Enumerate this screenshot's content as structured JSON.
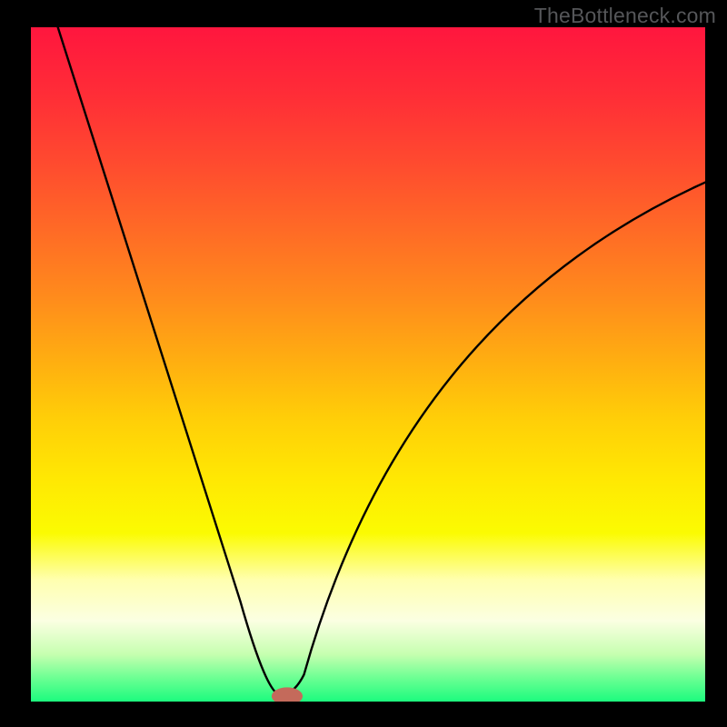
{
  "watermark": "TheBottleneck.com",
  "chart_data": {
    "type": "line",
    "title": "",
    "xlabel": "",
    "ylabel": "",
    "xlim": [
      0,
      100
    ],
    "ylim": [
      0,
      100
    ],
    "axes_visible": false,
    "grid": false,
    "background": {
      "type": "vertical_gradient",
      "stops": [
        {
          "offset": 0.0,
          "color": "#ff163e"
        },
        {
          "offset": 0.1,
          "color": "#ff2d37"
        },
        {
          "offset": 0.2,
          "color": "#ff4a2f"
        },
        {
          "offset": 0.3,
          "color": "#ff6a26"
        },
        {
          "offset": 0.4,
          "color": "#ff8b1c"
        },
        {
          "offset": 0.5,
          "color": "#ffb010"
        },
        {
          "offset": 0.58,
          "color": "#ffce08"
        },
        {
          "offset": 0.67,
          "color": "#ffe803"
        },
        {
          "offset": 0.75,
          "color": "#fbfb02"
        },
        {
          "offset": 0.82,
          "color": "#ffffb0"
        },
        {
          "offset": 0.88,
          "color": "#fbffe2"
        },
        {
          "offset": 0.93,
          "color": "#c6ffb0"
        },
        {
          "offset": 0.965,
          "color": "#6cff93"
        },
        {
          "offset": 1.0,
          "color": "#1cfb7e"
        }
      ]
    },
    "curve": {
      "description": "V-shaped bottleneck curve with smooth minimum",
      "min_x": 37,
      "min_y": 1,
      "left_top": {
        "x": 4,
        "y": 100
      },
      "right_end": {
        "x": 100,
        "y": 77
      },
      "stroke": "#000000",
      "stroke_width": 2.4
    },
    "marker": {
      "x": 38,
      "y": 0.8,
      "rx": 2.3,
      "ry": 1.3,
      "fill": "#c46a5b"
    }
  }
}
